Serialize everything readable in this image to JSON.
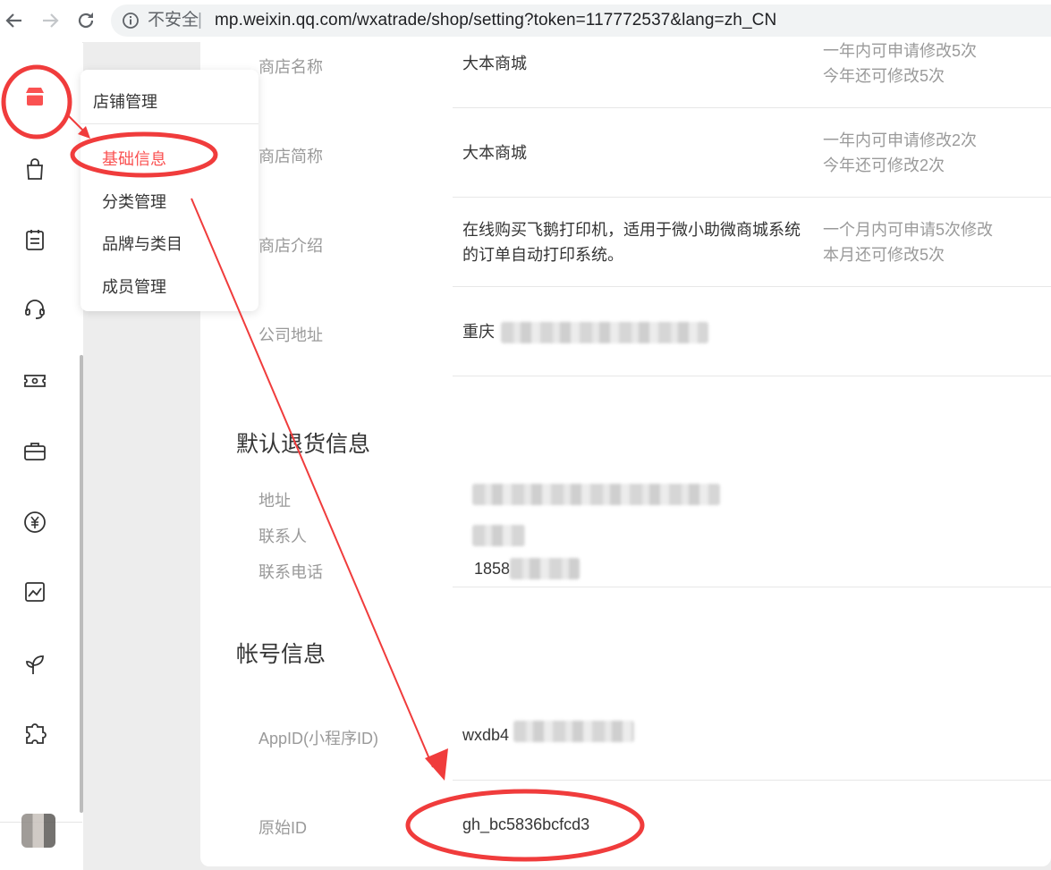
{
  "browser": {
    "insecure_label": "不安全",
    "separator": "|",
    "url": "mp.weixin.qq.com/wxatrade/shop/setting?token=117772537&lang=zh_CN"
  },
  "menu": {
    "title": "店铺管理",
    "items": [
      "基础信息",
      "分类管理",
      "品牌与类目",
      "成员管理"
    ],
    "active": "基础信息"
  },
  "shop_info": [
    {
      "label": "商店名称",
      "value": "大本商城",
      "hint1": "一年内可申请修改5次",
      "hint2": "今年还可修改5次"
    },
    {
      "label": "商店简称",
      "value": "大本商城",
      "hint1": "一年内可申请修改2次",
      "hint2": "今年还可修改2次"
    },
    {
      "label": "商店介绍",
      "value1": "在线购买飞鹅打印机，适用于微小助微商城系统",
      "value2": "的订单自动打印系统。",
      "hint1": "一个月内可申请5次修改",
      "hint2": "本月还可修改5次"
    },
    {
      "label": "公司地址",
      "value": "重庆"
    }
  ],
  "return_info": {
    "title": "默认退货信息",
    "address_label": "地址",
    "contact_label": "联系人",
    "phone_label": "联系电话",
    "phone_value": "1858"
  },
  "account_info": {
    "title": "帐号信息",
    "appid_label": "AppID(小程序ID)",
    "appid_value": "wxdb4",
    "origin_label": "原始ID",
    "origin_value": "gh_bc5836bcfcd3"
  },
  "colors": {
    "accent": "#fa5151",
    "annotation": "#f03c3c",
    "page_bg": "#ededed"
  }
}
